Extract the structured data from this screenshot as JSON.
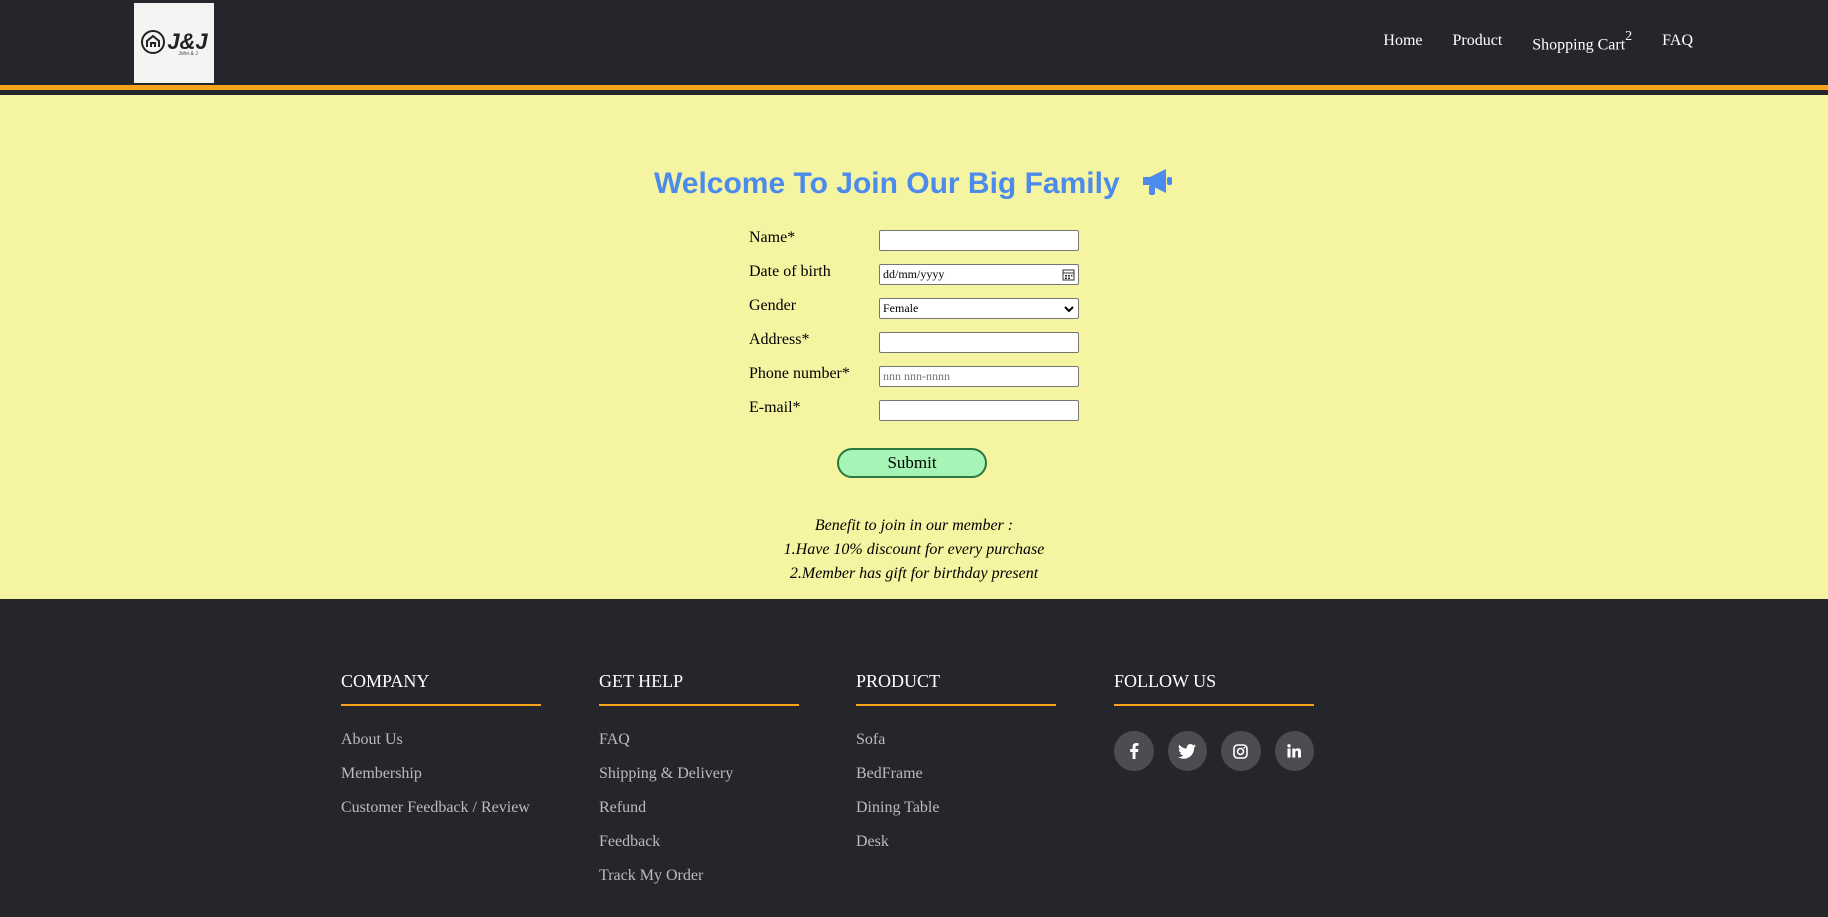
{
  "header": {
    "logo_text": "J&J",
    "logo_subtext": "John & J",
    "nav": [
      {
        "label": "Home"
      },
      {
        "label": "Product"
      },
      {
        "label": "Shopping Cart",
        "badge": "2"
      },
      {
        "label": "FAQ"
      }
    ]
  },
  "form": {
    "title": "Welcome To Join Our Big Family",
    "title_icon": "megaphone-icon",
    "fields": [
      {
        "label": "Name*",
        "value": "",
        "placeholder": ""
      },
      {
        "label": "Date of birth",
        "value": "dd/mm/yyyy"
      },
      {
        "label": "Gender",
        "value": "Female"
      },
      {
        "label": "Address*",
        "value": "",
        "placeholder": ""
      },
      {
        "label": "Phone number*",
        "value": "",
        "placeholder": "nnn nnn-nnnn"
      },
      {
        "label": "E-mail*",
        "value": "",
        "placeholder": ""
      }
    ],
    "submit_label": "Submit",
    "benefits": [
      "Benefit to join in our member :",
      "1.Have 10% discount for every purchase",
      "2.Member has gift for birthday present"
    ]
  },
  "footer": {
    "columns": [
      {
        "heading": "COMPANY",
        "items": [
          "About Us",
          "Membership",
          "Customer Feedback / Review"
        ]
      },
      {
        "heading": "GET HELP",
        "items": [
          "FAQ",
          "Shipping & Delivery",
          "Refund",
          "Feedback",
          "Track My Order"
        ]
      },
      {
        "heading": "PRODUCT",
        "items": [
          "Sofa",
          "BedFrame",
          "Dining Table",
          "Desk"
        ]
      },
      {
        "heading": "FOLLOW US",
        "social": [
          "facebook-icon",
          "twitter-icon",
          "instagram-icon",
          "linkedin-icon"
        ]
      }
    ]
  },
  "colors": {
    "header_bg": "#24262b",
    "accent": "#f7a31b",
    "main_bg": "#f5f4a1",
    "title": "#4c8aed",
    "submit_bg": "#a6f5b6"
  }
}
